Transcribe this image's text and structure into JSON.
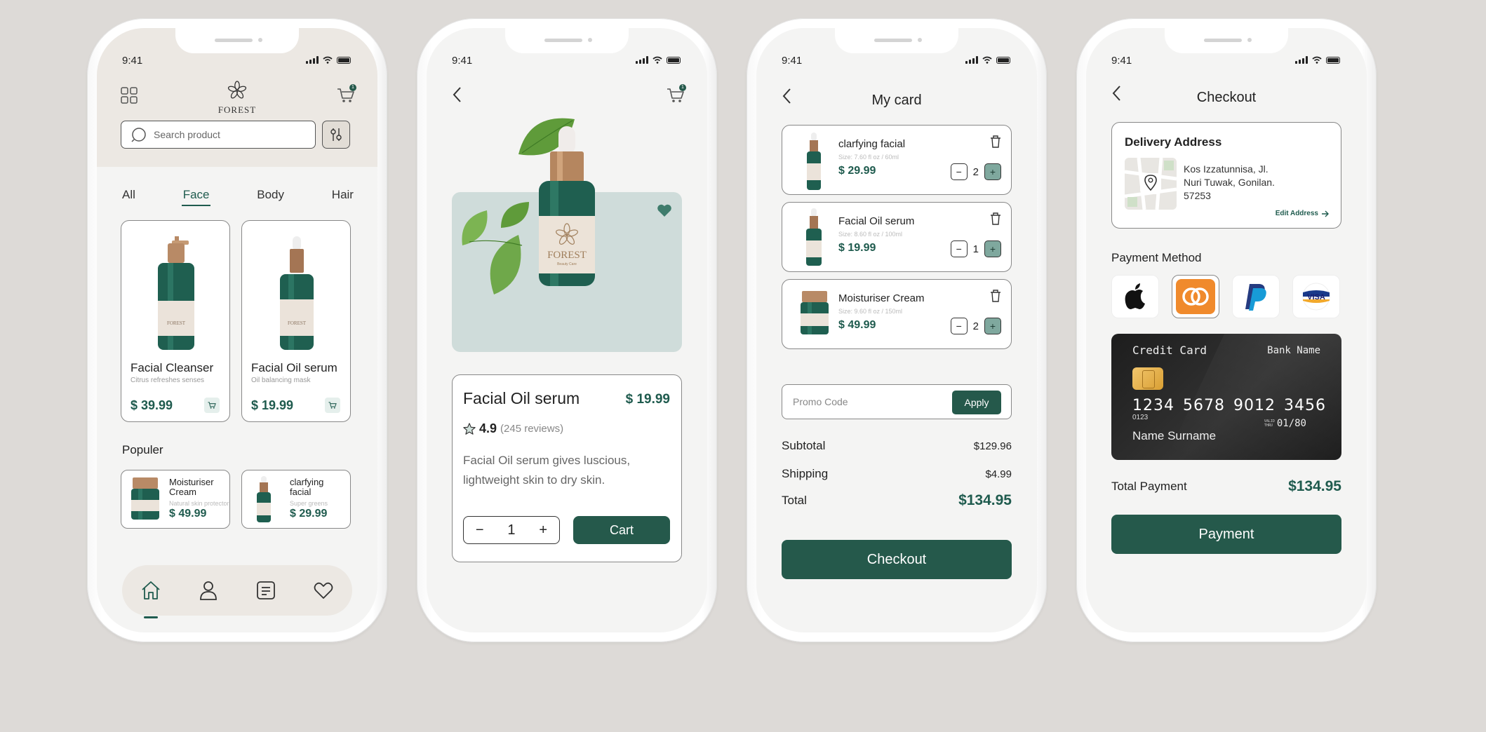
{
  "status_time": "9:41",
  "phone1": {
    "logo_text": "FOREST",
    "cart_badge": "1",
    "search": {
      "placeholder": "Search product"
    },
    "tabs": [
      "All",
      "Face",
      "Body",
      "Hair"
    ],
    "active_tab": "Face",
    "products": [
      {
        "name": "Facial Cleanser",
        "subtitle": "Citrus refreshes senses",
        "price": "$ 39.99"
      },
      {
        "name": "Facial Oil serum",
        "subtitle": "Oil balancing mask",
        "price": "$ 19.99"
      }
    ],
    "popular_title": "Populer",
    "popular": [
      {
        "name": "Moisturiser Cream",
        "subtitle": "Natural skin protector",
        "price": "$ 49.99"
      },
      {
        "name": "clarfying facial",
        "subtitle": "Super greens",
        "price": "$ 29.99"
      }
    ],
    "nav": [
      "home-icon",
      "user-icon",
      "list-icon",
      "heart-icon"
    ]
  },
  "phone2": {
    "cart_badge": "1",
    "product_name": "Facial Oil serum",
    "price": "$ 19.99",
    "rating": "4.9",
    "reviews": "(245 reviews)",
    "description": "Facial Oil serum gives luscious, lightweight skin to dry skin.",
    "quantity": "1",
    "cart_label": "Cart",
    "bottle_label": "FOREST",
    "bottle_sub": "Beauty Care"
  },
  "phone3": {
    "title": "My card",
    "items": [
      {
        "name": "clarfying facial",
        "size": "Size: 7.60 fl oz / 60ml",
        "price": "$ 29.99",
        "qty": "2"
      },
      {
        "name": "Facial Oil serum",
        "size": "Size: 8.60 fl oz / 100ml",
        "price": "$ 19.99",
        "qty": "1"
      },
      {
        "name": "Moisturiser Cream",
        "size": "Size: 9.60 fl oz / 150ml",
        "price": "$ 49.99",
        "qty": "2"
      }
    ],
    "promo_placeholder": "Promo Code",
    "apply_label": "Apply",
    "subtotal_label": "Subtotal",
    "subtotal": "$129.96",
    "shipping_label": "Shipping",
    "shipping": "$4.99",
    "total_label": "Total",
    "total": "$134.95",
    "checkout_label": "Checkout"
  },
  "phone4": {
    "title": "Checkout",
    "delivery_title": "Delivery Address",
    "address_lines": [
      "Kos Izzatunnisa, Jl.",
      "Nuri Tuwak, Gonilan.",
      "57253"
    ],
    "edit_label": "Edit Address",
    "payment_method_title": "Payment Method",
    "methods": [
      "apple-pay-icon",
      "mastercard-icon",
      "paypal-icon",
      "visa-icon"
    ],
    "selected_method": "mastercard-icon",
    "visa_text": "VISA",
    "card": {
      "label": "Credit Card",
      "bank": "Bank Name",
      "number": [
        "1234",
        "5678",
        "9012",
        "3456"
      ],
      "sub": "0123",
      "valid_label": "VALID THRU",
      "valid": "01/80",
      "holder": "Name Surname"
    },
    "total_label": "Total Payment",
    "total": "$134.95",
    "pay_label": "Payment"
  },
  "colors": {
    "accent": "#25594b",
    "background": "#dddad7",
    "screen": "#f4f4f3",
    "header": "#ece8e3"
  }
}
